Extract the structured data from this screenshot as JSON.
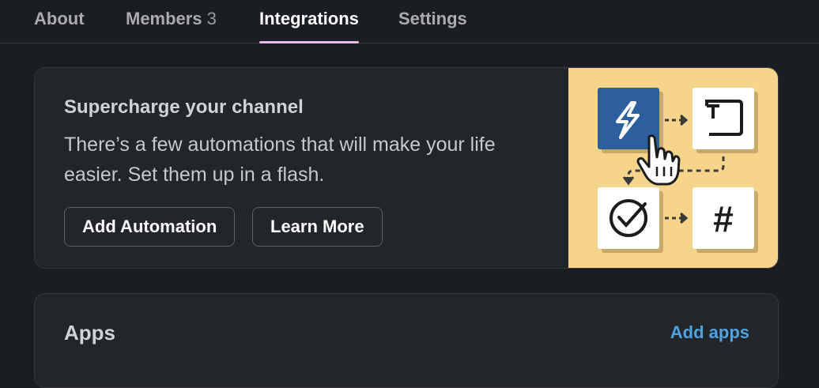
{
  "tabs": [
    {
      "label": "About"
    },
    {
      "label": "Members",
      "count": "3"
    },
    {
      "label": "Integrations",
      "active": true
    },
    {
      "label": "Settings"
    }
  ],
  "promo": {
    "title": "Supercharge your channel",
    "description": "There’s a few automations that will make your life easier. Set them up in a flash.",
    "add_automation_label": "Add Automation",
    "learn_more_label": "Learn More",
    "illustration": {
      "icons": [
        "lightning-icon",
        "text-icon",
        "check-circle-icon",
        "hashtag-icon",
        "hand-cursor-icon"
      ],
      "hashtag_glyph": "#"
    }
  },
  "apps": {
    "title": "Apps",
    "add_apps_label": "Add apps"
  },
  "colors": {
    "background": "#1a1d21",
    "card": "#222529",
    "active_tab_underline": "#e8b9e9",
    "link": "#4fa3e0",
    "illustration_bg": "#f6d58a",
    "lightning_tile": "#2d5f9e"
  }
}
